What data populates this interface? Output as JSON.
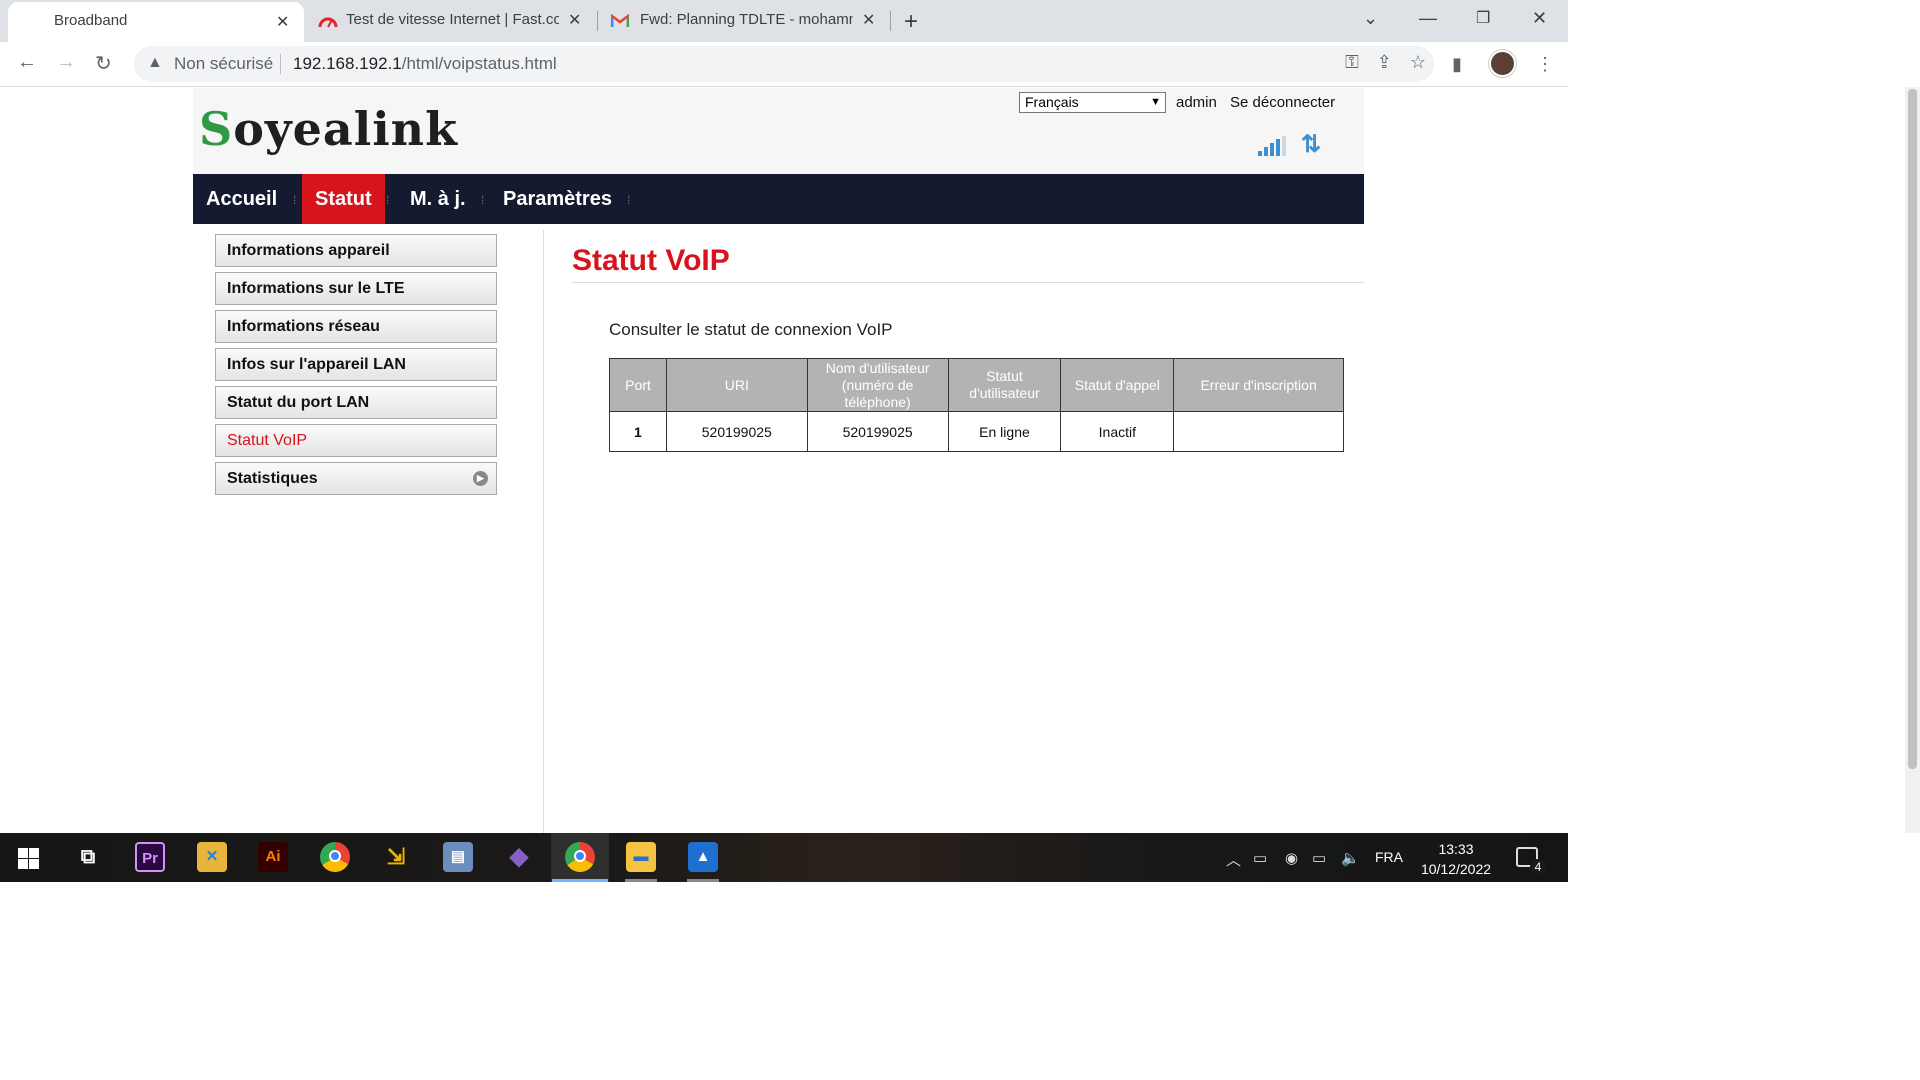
{
  "browser": {
    "tabs": [
      {
        "title": "Broadband"
      },
      {
        "title": "Test de vitesse Internet | Fast.com"
      },
      {
        "title": "Fwd: Planning TDLTE - mohamme"
      }
    ],
    "security_label": "Non sécurisé",
    "url_host": "192.168.192.1",
    "url_path": "/html/voipstatus.html"
  },
  "header": {
    "brand": "Soyealink",
    "language": "Français",
    "user": "admin",
    "logout": "Se déconnecter",
    "signal_level": 4
  },
  "menu": [
    {
      "label": "Accueil",
      "active": false
    },
    {
      "label": "Statut",
      "active": true
    },
    {
      "label": "M. à j.",
      "active": false
    },
    {
      "label": "Paramètres",
      "active": false
    }
  ],
  "sidebar": [
    {
      "label": "Informations appareil"
    },
    {
      "label": "Informations sur le LTE"
    },
    {
      "label": "Informations réseau"
    },
    {
      "label": "Infos sur l'appareil LAN"
    },
    {
      "label": "Statut du port LAN"
    },
    {
      "label": "Statut VoIP",
      "active": true
    },
    {
      "label": "Statistiques",
      "has_submenu": true
    }
  ],
  "main": {
    "title": "Statut VoIP",
    "description": "Consulter le statut de connexion VoIP",
    "table": {
      "headers": [
        "Port",
        "URI",
        "Nom d'utilisateur (numéro de téléphone)",
        "Statut d'utilisateur",
        "Statut d'appel",
        "Erreur d'inscription"
      ],
      "rows": [
        [
          "1",
          "520199025",
          "520199025",
          "En ligne",
          "Inactif",
          ""
        ]
      ]
    }
  },
  "taskbar": {
    "language": "FRA",
    "time": "13:33",
    "date": "10/12/2022",
    "notifications": "4",
    "apps": [
      {
        "label": "Pr",
        "color": "#d291ff"
      },
      {
        "label": "Ai",
        "color": "#ff7c00"
      }
    ]
  }
}
